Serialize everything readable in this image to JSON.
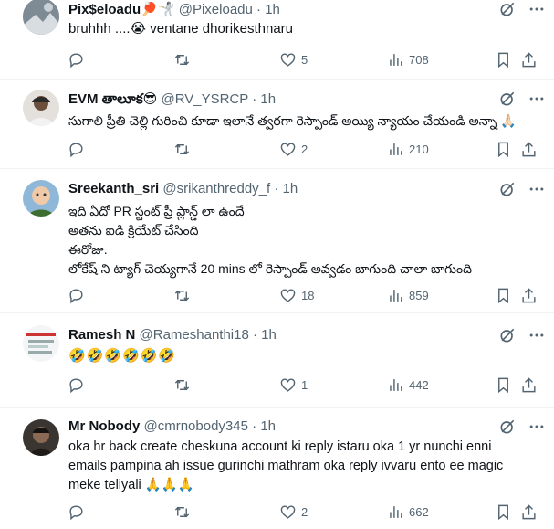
{
  "tweets": [
    {
      "name": "Pix$eloadu",
      "name_emoji": "🏓🤺",
      "handle": "@Pixeloadu",
      "time": "1h",
      "lines": [
        "bruhhh ....😭  ventane dhorikesthnaru"
      ],
      "replies": "",
      "retweets": "",
      "likes": "5",
      "views": "708"
    },
    {
      "name": "EVM తాలూక",
      "name_emoji": "😎",
      "handle": "@RV_YSRCP",
      "time": "1h",
      "lines": [
        "సుగాలి ప్రీతి చెల్లి గురించి కూడా ఇలానే త్వరగా రెస్పాండ్ అయ్యి న్యాయం చేయండి అన్నా 🙏🏻"
      ],
      "replies": "",
      "retweets": "",
      "likes": "2",
      "views": "210"
    },
    {
      "name": "Sreekanth_sri",
      "name_emoji": "",
      "handle": "@srikanthreddy_f",
      "time": "1h",
      "lines": [
        "ఇది ఏదో PR స్టంట్ ప్రీ ప్లాన్డ్ లా ఉందే",
        "అతను ఐడి క్రియేట్ చేసింది",
        "ఈరోజు.",
        "లోకేష్ ని ట్యాగ్ చెయ్యగానే 20 mins లో రెస్పాండ్ అవ్వడం బాగుంది చాలా బాగుంది"
      ],
      "replies": "",
      "retweets": "",
      "likes": "18",
      "views": "859"
    },
    {
      "name": "Ramesh N",
      "name_emoji": "",
      "handle": "@Rameshanthi18",
      "time": "1h",
      "lines": [
        "🤣🤣🤣🤣🤣🤣"
      ],
      "replies": "",
      "retweets": "",
      "likes": "1",
      "views": "442"
    },
    {
      "name": "Mr Nobody",
      "name_emoji": "",
      "handle": "@cmrnobody345",
      "time": "1h",
      "lines": [
        "oka hr back create cheskuna account ki reply istaru oka 1 yr nunchi enni",
        "emails pampina ah issue gurinchi mathram oka reply ivvaru ento ee magic",
        "meke teliyali 🙏🙏🙏"
      ],
      "replies": "",
      "retweets": "",
      "likes": "2",
      "views": "662"
    }
  ],
  "separator": "·",
  "colors": {
    "text": "#0f1419",
    "secondary": "#536471",
    "border": "#eff3f4"
  },
  "icons": [
    "reply-icon",
    "retweet-icon",
    "like-icon",
    "views-icon",
    "bookmark-icon",
    "share-icon",
    "grok-icon",
    "more-icon"
  ]
}
